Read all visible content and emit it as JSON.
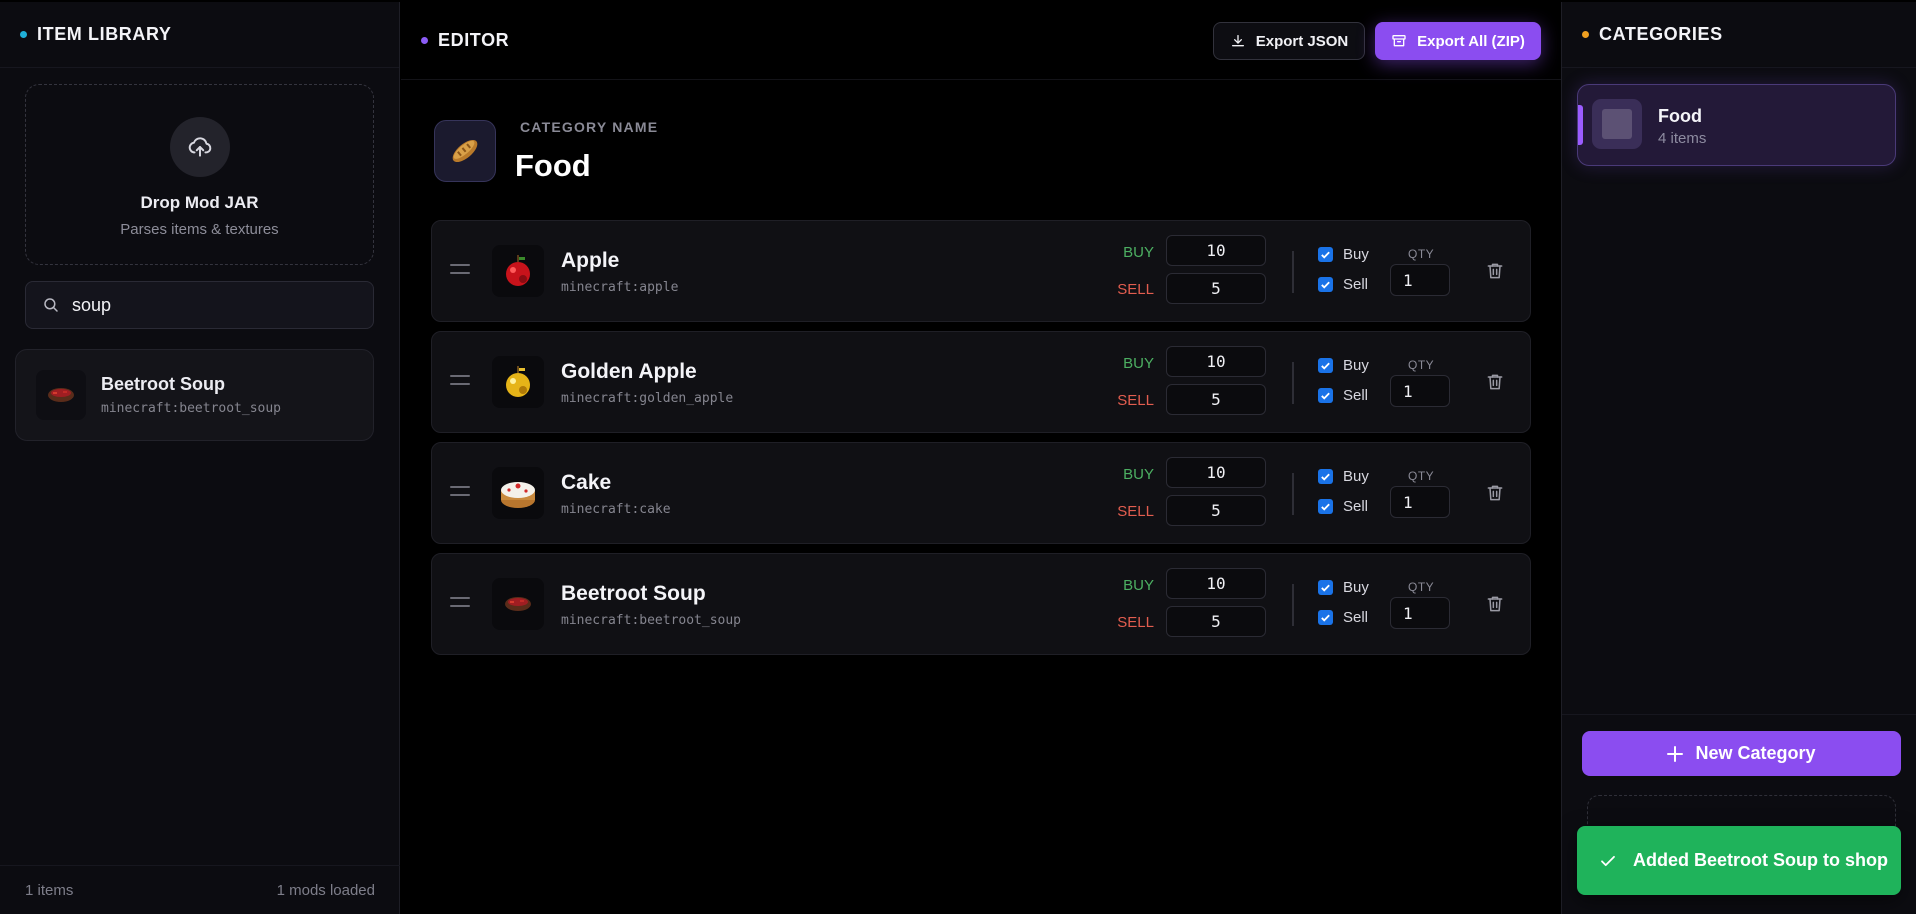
{
  "library": {
    "title": "ITEM LIBRARY",
    "dot_color": "#1fb0d8",
    "drop_title": "Drop Mod JAR",
    "drop_subtitle": "Parses items & textures",
    "search_value": "soup",
    "results": [
      {
        "name": "Beetroot Soup",
        "id": "minecraft:beetroot_soup",
        "icon": "beetroot-soup-icon"
      }
    ],
    "footer_items": "1 items",
    "footer_mods": "1 mods loaded"
  },
  "editor": {
    "title": "EDITOR",
    "dot_color": "#8b5cf6",
    "export_json_label": "Export JSON",
    "export_all_label": "Export All (ZIP)",
    "category_label": "CATEGORY NAME",
    "category_name": "Food",
    "category_icon": "bread-icon",
    "buy_label": "BUY",
    "sell_label": "SELL",
    "buy_check_label": "Buy",
    "sell_check_label": "Sell",
    "qty_label": "QTY",
    "items": [
      {
        "name": "Apple",
        "id": "minecraft:apple",
        "icon": "apple-icon",
        "buy": "10",
        "sell": "5",
        "buy_enabled": true,
        "sell_enabled": true,
        "qty": "1"
      },
      {
        "name": "Golden Apple",
        "id": "minecraft:golden_apple",
        "icon": "golden-apple-icon",
        "buy": "10",
        "sell": "5",
        "buy_enabled": true,
        "sell_enabled": true,
        "qty": "1"
      },
      {
        "name": "Cake",
        "id": "minecraft:cake",
        "icon": "cake-icon",
        "buy": "10",
        "sell": "5",
        "buy_enabled": true,
        "sell_enabled": true,
        "qty": "1"
      },
      {
        "name": "Beetroot Soup",
        "id": "minecraft:beetroot_soup",
        "icon": "beetroot-soup-icon",
        "buy": "10",
        "sell": "5",
        "buy_enabled": true,
        "sell_enabled": true,
        "qty": "1"
      }
    ]
  },
  "categories": {
    "title": "CATEGORIES",
    "dot_color": "#f0a020",
    "list": [
      {
        "name": "Food",
        "count": "4 items",
        "active": true
      }
    ],
    "new_category_label": "New Category"
  },
  "toast": {
    "message": "Added Beetroot Soup to shop",
    "color": "#1fb35b"
  },
  "colors": {
    "accent": "#8b4df0",
    "buy": "#4caf62",
    "sell": "#e25d4f",
    "checkbox": "#1a73e8"
  }
}
